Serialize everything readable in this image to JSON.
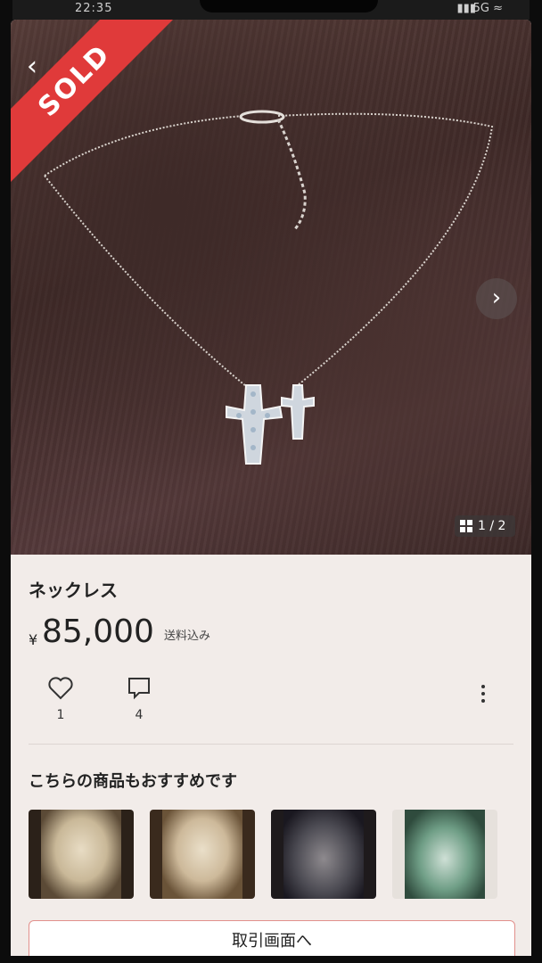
{
  "status_bar": {
    "time": "22:35",
    "signal": "▮▮▮",
    "network": "5G ≈"
  },
  "listing": {
    "sold_label": "SOLD",
    "image_counter": "1 / 2",
    "title": "ネックレス",
    "currency": "¥",
    "price": "85,000",
    "shipping": "送料込み",
    "likes": "1",
    "comments": "4"
  },
  "recommend": {
    "title": "こちらの商品もおすすめです",
    "items": [
      {
        "name": "ivory-figure-1"
      },
      {
        "name": "ivory-figure-2"
      },
      {
        "name": "jade-pendant-dark"
      },
      {
        "name": "jade-pendant-green"
      }
    ]
  },
  "trade_button_label": "取引画面へ",
  "colors": {
    "sold": "#e03a3a",
    "accent": "#e2908c",
    "background": "#f2ece9"
  }
}
